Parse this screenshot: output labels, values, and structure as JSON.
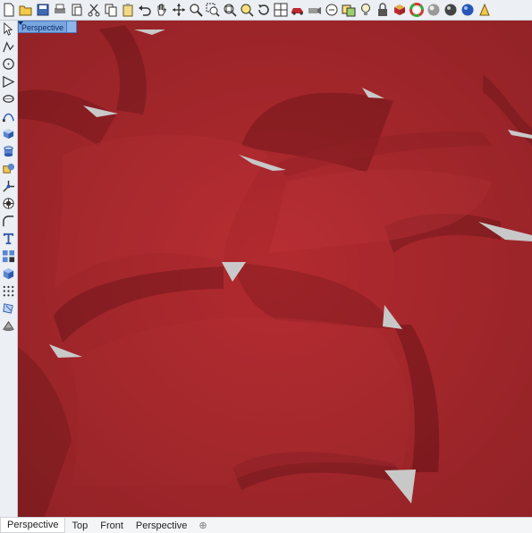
{
  "colors": {
    "surface": "#b32b30",
    "surface_dark": "#7a1a1e",
    "gap": "#c8c8c8",
    "viewport_title_bg": "#7aa6e0"
  },
  "toolbar": {
    "icons": [
      "new-file-icon",
      "open-folder-icon",
      "save-icon",
      "print-icon",
      "import-icon",
      "cut-icon",
      "copy-icon",
      "paste-icon",
      "undo-icon",
      "pan-hand-icon",
      "move-icon",
      "zoom-icon",
      "zoom-window-icon",
      "zoom-extents-icon",
      "zoom-selected-icon",
      "rotate-view-icon",
      "four-viewports-icon",
      "car-icon",
      "camera-icon",
      "select-icon",
      "layer-icon",
      "light-bulb-icon",
      "lock-icon",
      "material-icon",
      "color-wheel-icon",
      "shaded-sphere-icon",
      "rendered-sphere-icon",
      "globe-sphere-icon",
      "render-cone-icon"
    ]
  },
  "left_toolbar": {
    "icons": [
      "select-arrow-icon",
      "polyline-icon",
      "circle-icon",
      "arc-icon",
      "ellipse-icon",
      "curve-edit-icon",
      "solid-box-icon",
      "cylinder-icon",
      "boolean-icon",
      "gumball-icon",
      "mesh-icon",
      "fillet-icon",
      "text-icon",
      "array-icon",
      "block-icon",
      "grid-snap-icon",
      "analyze-icon",
      "cone-icon"
    ]
  },
  "viewport": {
    "title": "Perspective"
  },
  "tabs": [
    {
      "label": "Perspective",
      "active": true
    },
    {
      "label": "Top",
      "active": false
    },
    {
      "label": "Front",
      "active": false
    },
    {
      "label": "Perspective",
      "active": false
    }
  ],
  "add_tab_symbol": "⊕"
}
